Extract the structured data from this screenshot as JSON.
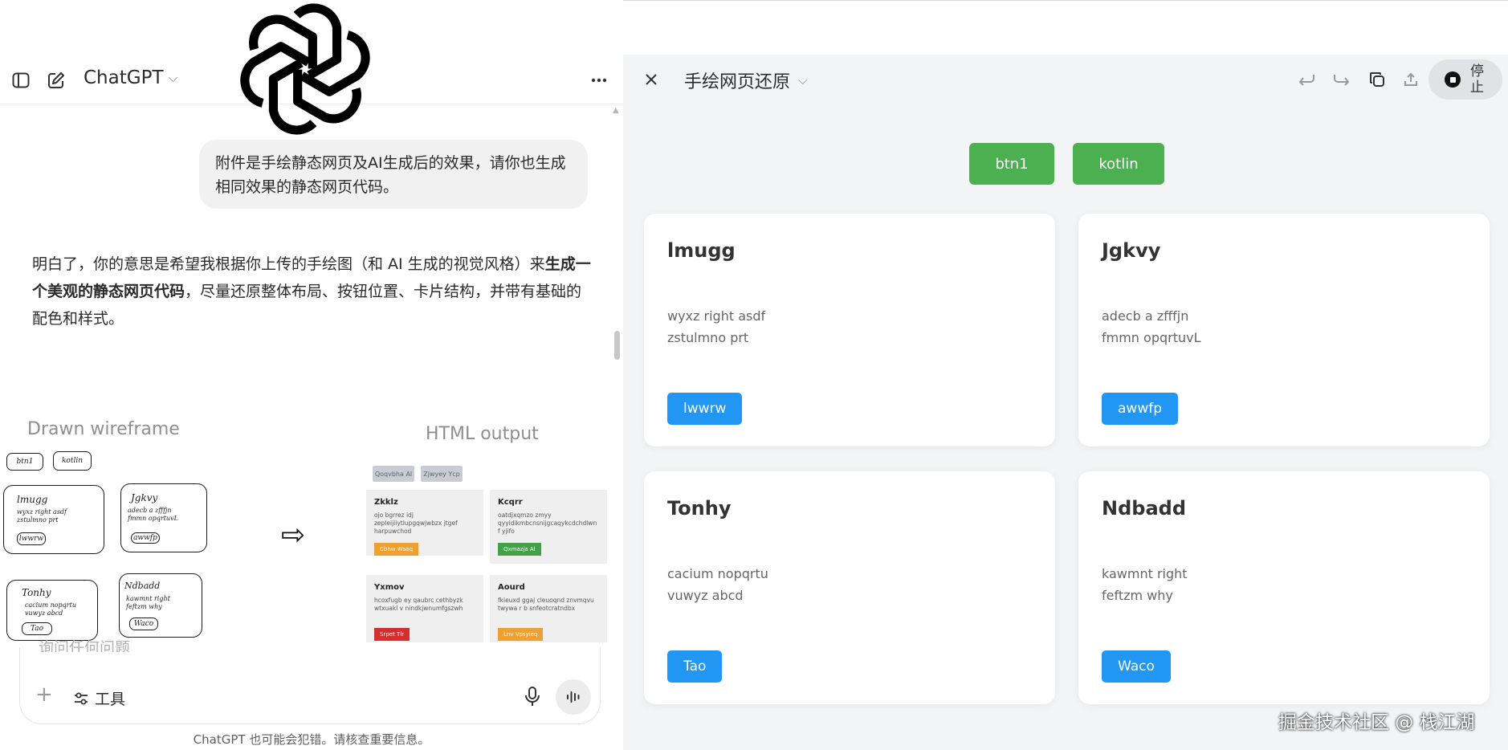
{
  "left": {
    "header": {
      "title": "ChatGPT"
    },
    "user_message": "附件是手绘静态网页及AI生成后的效果，请你也生成相同效果的静态网页代码。",
    "answer": {
      "part1": "明白了，你的意思是希望我根据你上传的手绘图（和 AI 生成的视觉风格）来",
      "bold": "生成一个美观的静态网页代码",
      "part2": "，尽量还原整体布局、按钮位置、卡片结构，并带有基础的配色和样式。"
    },
    "comparison": {
      "left_label": "Drawn wireframe",
      "right_label": "HTML output",
      "sketch": {
        "buttons": [
          "btn1",
          "kotlin"
        ],
        "cards": [
          {
            "title": "lmugg",
            "l1": "wyxz right asdf",
            "l2": "zstulmno prt",
            "btn": "lwwrw"
          },
          {
            "title": "Jgkvy",
            "l1": "adecb a zfffjn",
            "l2": "fmmn opqrtuvL",
            "btn": "awwfp"
          },
          {
            "title": "Tonhy",
            "l1": "cacium nopqrtu",
            "l2": "vuwyz abcd",
            "btn": "Tao"
          },
          {
            "title": "Ndbadd",
            "l1": "kawmnt right",
            "l2": "feftzm why",
            "btn": "Waco"
          }
        ]
      },
      "output": {
        "chips": [
          "Qoqvbha Al",
          "Zjwyey Ycp"
        ],
        "cards": [
          {
            "title": "Zkklz",
            "body": "ojo bgrrez idj zepleijiiytlupgqwjwbzx jtgef harpuwchod",
            "btn": "Cbhw Wsoq",
            "color": "#f0a030"
          },
          {
            "title": "Kcqrr",
            "body": "oatdjxqmzo zmyy qyyidikmbcnsnijgcaqykcdchdlwn f yjifo",
            "btn": "Qxmazja Al",
            "color": "#43a047"
          },
          {
            "title": "Yxmov",
            "body": "hcoxfugb ey qaubrc cethbyzk wtxuakl v nindkjwnumfgszwh",
            "btn": "Srpet Tlr",
            "color": "#d32f2f"
          },
          {
            "title": "Aourd",
            "body": "fkieuxd ggaj cleuoqnd znvmqvu twywa r b snfeotcratndbx",
            "btn": "Lnv Vpsyieq",
            "color": "#f0a030"
          }
        ]
      }
    },
    "input": {
      "placeholder": "询问任何问题",
      "tools_label": "工具"
    },
    "disclaimer": "ChatGPT 也可能会犯错。请核查重要信息。"
  },
  "right": {
    "header": {
      "title": "手绘网页还原",
      "stop_label": "停止"
    },
    "top_buttons": [
      "btn1",
      "kotlin"
    ],
    "cards": [
      {
        "title": "lmugg",
        "line1": "wyxz right asdf",
        "line2": "zstulmno prt",
        "button": "lwwrw"
      },
      {
        "title": "Jgkvy",
        "line1": "adecb a zfffjn",
        "line2": "fmmn opqrtuvL",
        "button": "awwfp"
      },
      {
        "title": "Tonhy",
        "line1": "cacium nopqrtu",
        "line2": "vuwyz abcd",
        "button": "Tao"
      },
      {
        "title": "Ndbadd",
        "line1": "kawmnt right",
        "line2": "feftzm why",
        "button": "Waco"
      }
    ],
    "colors": {
      "green_button": "#4caf50",
      "blue_button": "#2196f3",
      "background": "#f3f4f6"
    }
  },
  "watermark": "掘金技术社区 @ 栈江湖"
}
